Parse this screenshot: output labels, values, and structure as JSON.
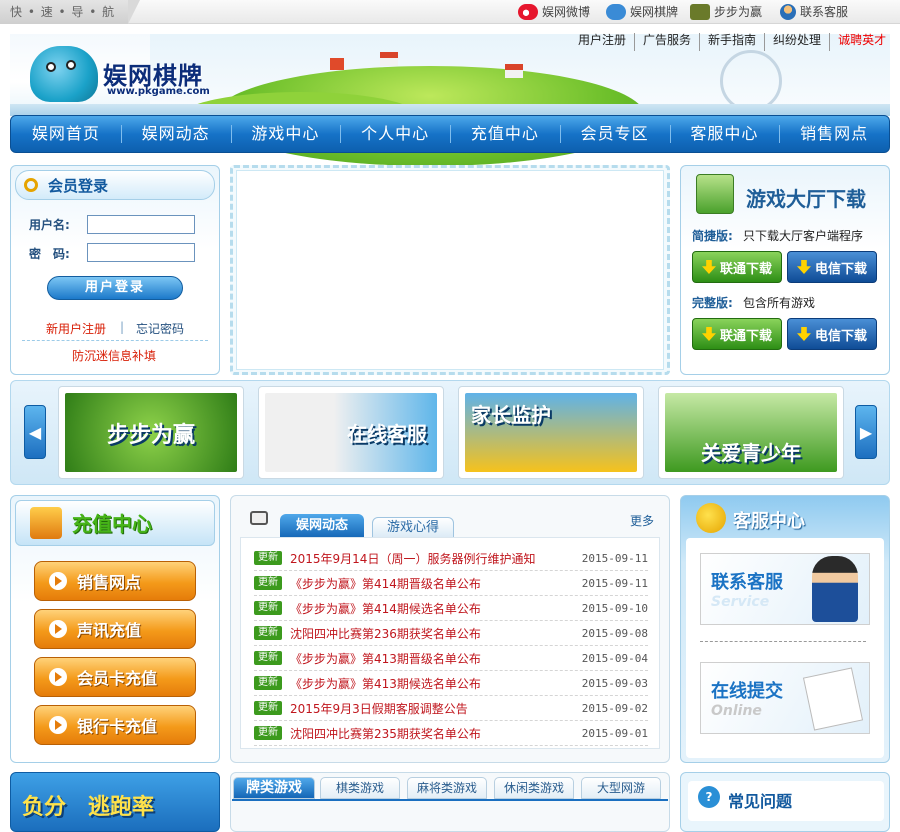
{
  "topbar": {
    "quicknav": "快 • 速 • 导 • 航",
    "links": [
      "娱网微博",
      "娱网棋牌",
      "步步为赢",
      "联系客服"
    ]
  },
  "header": {
    "logo_text": "娱网棋牌",
    "logo_url": "www.pkgame.com",
    "links": [
      "用户注册",
      "广告服务",
      "新手指南",
      "纠纷处理",
      "诚聘英才"
    ]
  },
  "nav": [
    "娱网首页",
    "娱网动态",
    "游戏中心",
    "个人中心",
    "充值中心",
    "会员专区",
    "客服中心",
    "销售网点"
  ],
  "login": {
    "title": "会员登录",
    "username_label": "用户名:",
    "password_label": "密　码:",
    "button": "用户登录",
    "register": "新用户注册",
    "forgot": "忘记密码",
    "addiction": "防沉迷信息补填"
  },
  "download": {
    "title": "游戏大厅下载",
    "lite_label": "简捷版:",
    "lite_desc": "只下载大厅客户端程序",
    "full_label": "完整版:",
    "full_desc": "包含所有游戏",
    "unicom": "联通下载",
    "telecom": "电信下载"
  },
  "carousel": {
    "items": [
      "步步为赢",
      "在线客服",
      "家长监护",
      "关爱青少年"
    ],
    "colors": [
      "#3b8f1e",
      "#1a7fc4",
      "#e69a10",
      "#2e9e2a"
    ]
  },
  "recharge": {
    "title": "充值中心",
    "buttons": [
      "销售网点",
      "声讯充值",
      "会员卡充值",
      "银行卡充值"
    ]
  },
  "news": {
    "tabs": [
      "娱网动态",
      "游戏心得"
    ],
    "more": "更多",
    "badge": "更新",
    "items": [
      {
        "title": "2015年9月14日（周一）服务器例行维护通知",
        "date": "2015-09-11"
      },
      {
        "title": "《步步为赢》第414期晋级名单公布",
        "date": "2015-09-11"
      },
      {
        "title": "《步步为赢》第414期候选名单公布",
        "date": "2015-09-10"
      },
      {
        "title": "沈阳四冲比赛第236期获奖名单公布",
        "date": "2015-09-08"
      },
      {
        "title": "《步步为赢》第413期晋级名单公布",
        "date": "2015-09-04"
      },
      {
        "title": "《步步为赢》第413期候选名单公布",
        "date": "2015-09-03"
      },
      {
        "title": "2015年9月3日假期客服调整公告",
        "date": "2015-09-02"
      },
      {
        "title": "沈阳四冲比赛第235期获奖名单公布",
        "date": "2015-09-01"
      }
    ]
  },
  "service": {
    "title": "客服中心",
    "contact": "联系客服",
    "contact_sub": "Service",
    "submit": "在线提交",
    "submit_sub": "Online"
  },
  "bottom": {
    "promo": "负分　逃跑率",
    "game_tabs": [
      "牌类游戏",
      "棋类游戏",
      "麻将类游戏",
      "休闲类游戏",
      "大型网游"
    ],
    "faq": "常见问题"
  }
}
